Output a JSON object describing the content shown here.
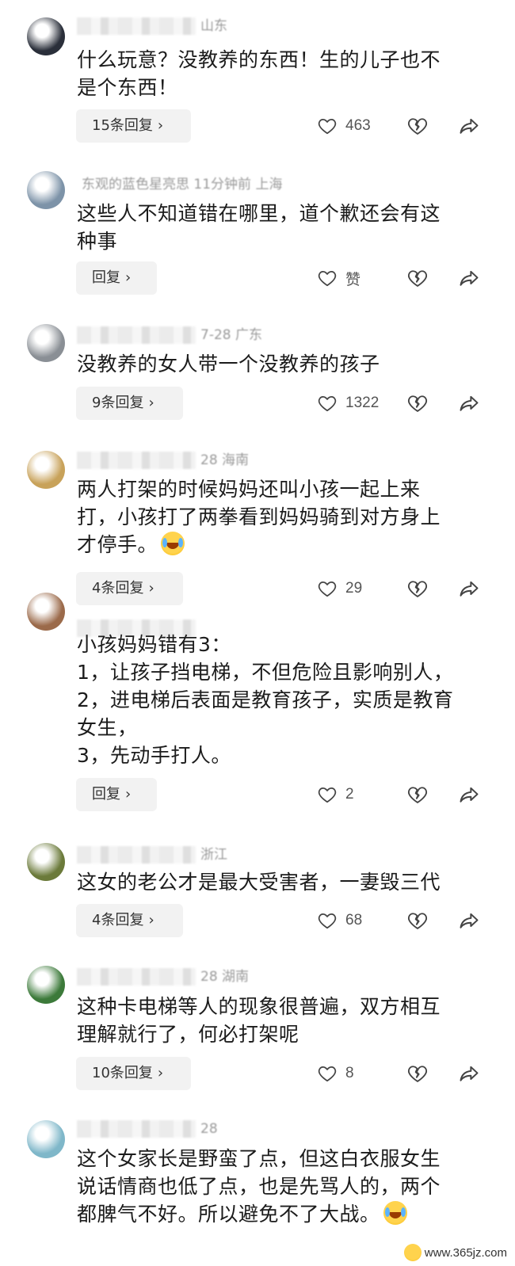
{
  "comments": [
    {
      "meta_location": "山东",
      "text": "什么玩意？没教养的东西！生的儿子也不\n是个东西！",
      "reply_label": "15条回复",
      "likes": "463",
      "avatar_color": "#2a2f3a"
    },
    {
      "meta_location": "东观的蓝色星亮思  11分钟前  上海",
      "text": "这些人不知道错在哪里，道个歉还会有这\n种事",
      "reply_label": "回复",
      "likes": "赞",
      "avatar_color": "#7d93a8"
    },
    {
      "meta_location": "7-28  广东",
      "text": "没教养的女人带一个没教养的孩子",
      "reply_label": "9条回复",
      "likes": "1322",
      "avatar_color": "#8a8f95"
    },
    {
      "meta_location": "28  海南",
      "text": "两人打架的时候妈妈还叫小孩一起上来\n打，小孩打了两拳看到妈妈骑到对方身上\n才停手。",
      "has_emoji": true,
      "reply_label": "4条回复",
      "likes": "29",
      "avatar_color": "#c8a25a"
    },
    {
      "meta_location": "",
      "text": "小孩妈妈错有3：\n1，让孩子挡电梯，不但危险且影响别人，\n2，进电梯后表面是教育孩子，实质是教育\n女生，\n3，先动手打人。",
      "reply_label": "回复",
      "likes": "2",
      "avatar_color": "#9b6a4a"
    },
    {
      "meta_location": "浙江",
      "text": "这女的老公才是最大受害者，一妻毁三代",
      "reply_label": "4条回复",
      "likes": "68",
      "avatar_color": "#6b7a3a"
    },
    {
      "meta_location": "28  湖南",
      "text": "这种卡电梯等人的现象很普遍，双方相互\n理解就行了，何必打架呢",
      "reply_label": "10条回复",
      "likes": "8",
      "avatar_color": "#3c7a3a"
    },
    {
      "meta_location": "28",
      "text": "这个女家长是野蛮了点，但这白衣服女生\n说话情商也低了点，也是先骂人的，两个\n都脾气不好。所以避免不了大战。",
      "has_emoji": true,
      "reply_label": "",
      "likes": "",
      "avatar_color": "#7fb7c9"
    }
  ],
  "watermark": "www.365jz.com",
  "icons": {
    "like": "heart-outline-icon",
    "dislike": "broken-heart-icon",
    "share": "share-arrow-icon",
    "chevron": "chevron-right-icon"
  }
}
